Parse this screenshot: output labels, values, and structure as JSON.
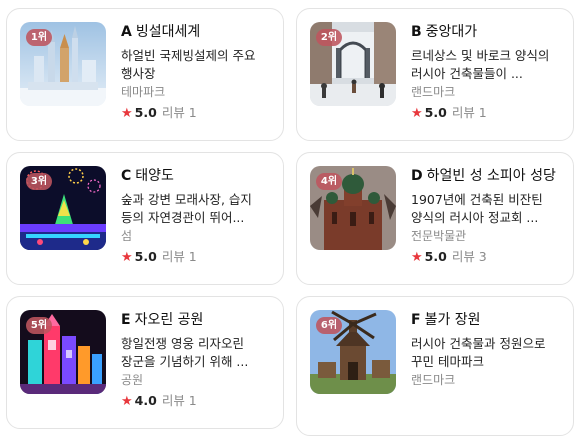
{
  "cards": [
    {
      "rank": "1위",
      "letter": "A",
      "name": "빙설대세계",
      "desc": "하얼빈 국제빙설제의 주요 행사장",
      "category": "테마파크",
      "score": "5.0",
      "reviews": "리뷰 1",
      "image": "ice-castle-photo"
    },
    {
      "rank": "2위",
      "letter": "B",
      "name": "중앙대가",
      "desc": "르네상스 및 바로크 양식의 러시아 건축물들이 ...",
      "category": "랜드마크",
      "score": "5.0",
      "reviews": "리뷰 1",
      "image": "snowy-street-photo"
    },
    {
      "rank": "3위",
      "letter": "C",
      "name": "태양도",
      "desc": "숲과 강변 모래사장, 습지 등의 자연경관이 뛰어...",
      "category": "섬",
      "score": "5.0",
      "reviews": "리뷰 1",
      "image": "light-festival-photo"
    },
    {
      "rank": "4위",
      "letter": "D",
      "name": "하얼빈 성 소피아 성당",
      "desc": "1907년에 건축된 비잔틴 양식의 러시아 정교회 ...",
      "category": "전문박물관",
      "score": "5.0",
      "reviews": "리뷰 3",
      "image": "cathedral-photo"
    },
    {
      "rank": "5위",
      "letter": "E",
      "name": "자오린 공원",
      "desc": "항일전쟁 영웅 리자오린 장군을 기념하기 위해 ...",
      "category": "공원",
      "score": "4.0",
      "reviews": "리뷰 1",
      "image": "ice-lantern-photo"
    },
    {
      "rank": "6위",
      "letter": "F",
      "name": "볼가 장원",
      "desc": "러시아 건축물과 정원으로 꾸민 테마파크",
      "category": "랜드마크",
      "score": null,
      "reviews": null,
      "image": "windmill-photo"
    }
  ],
  "colors": {
    "star": "#e8383d",
    "rank_badge": "#be555f",
    "muted": "#8a8a8a"
  },
  "icons": {
    "rating": "star-icon"
  }
}
